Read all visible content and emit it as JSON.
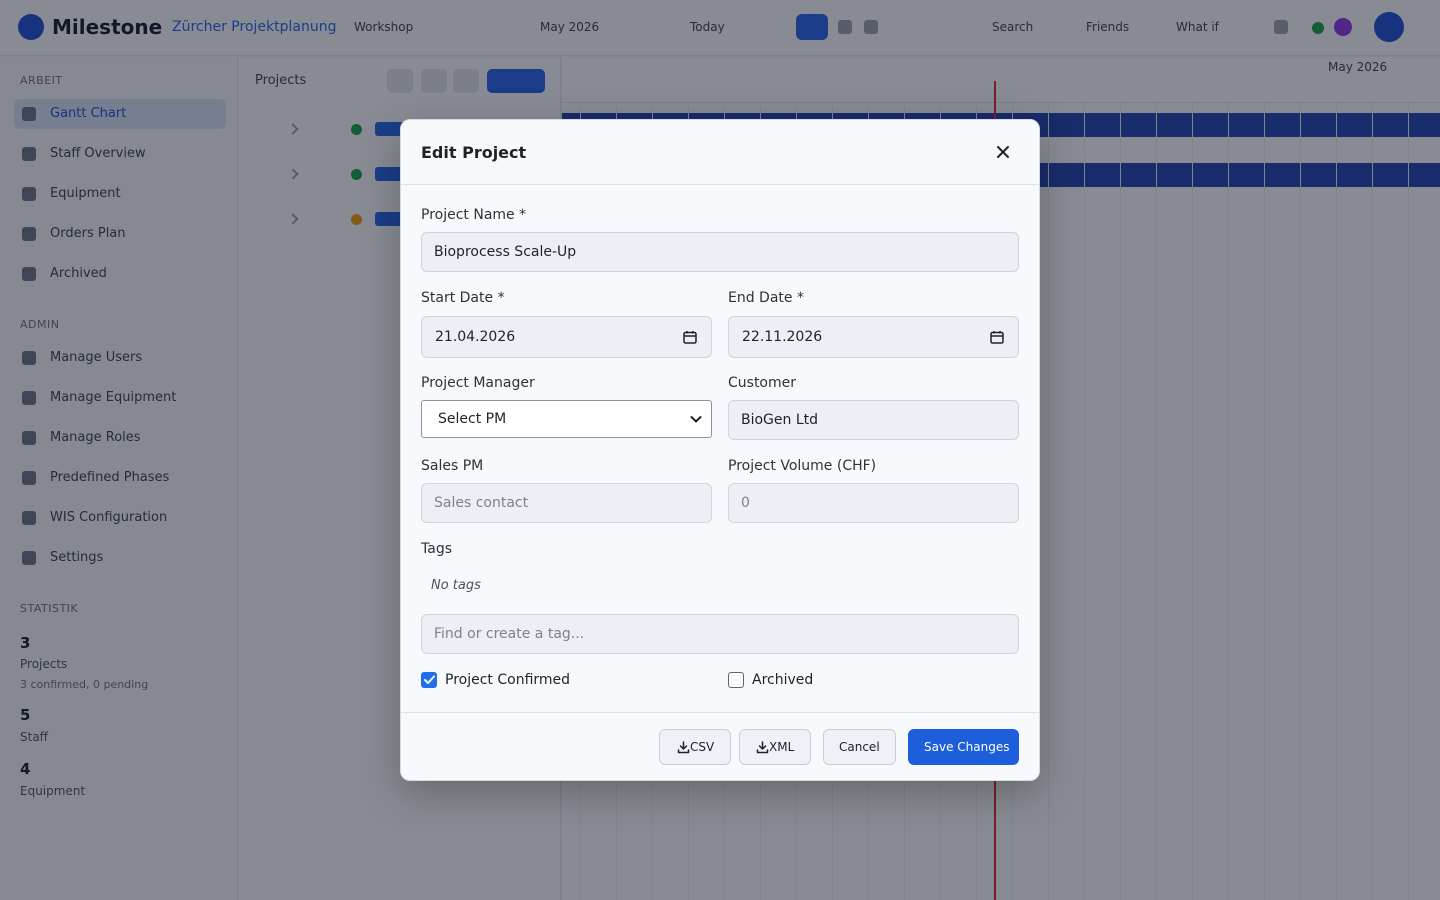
{
  "app": {
    "logo": "Milestone",
    "org": "Zürcher Projektplanung",
    "header_controls": [
      "Workshop",
      "May 2026",
      "Today",
      "Search",
      "Friends",
      "What if"
    ],
    "sidebar": {
      "sections": [
        "ARBEIT",
        "ADMIN",
        "STATISTIK"
      ],
      "items": [
        "Gantt Chart",
        "Staff Overview",
        "Equipment",
        "Orders Plan",
        "Archived",
        "Manage Users",
        "Manage Equipment",
        "Manage Roles",
        "Predefined Phases",
        "WIS Configuration",
        "Settings"
      ],
      "stats": [
        {
          "value": "3",
          "label": "Projects",
          "sub": "3 confirmed, 0 pending"
        },
        {
          "value": "5",
          "label": "Staff"
        },
        {
          "value": "4",
          "label": "Equipment"
        }
      ]
    },
    "projects_panel": {
      "title": "Projects"
    },
    "gantt": {
      "month": "May 2026"
    }
  },
  "modal": {
    "title": "Edit Project",
    "fields": {
      "project_name": {
        "label": "Project Name *",
        "value": "Bioprocess Scale-Up"
      },
      "start_date": {
        "label": "Start Date *",
        "value": "21.04.2026"
      },
      "end_date": {
        "label": "End Date *",
        "value": "22.11.2026"
      },
      "project_manager": {
        "label": "Project Manager",
        "selected": "Select PM"
      },
      "customer": {
        "label": "Customer",
        "value": "BioGen Ltd"
      },
      "sales_pm": {
        "label": "Sales PM",
        "placeholder": "Sales contact"
      },
      "project_volume": {
        "label": "Project Volume (CHF)",
        "placeholder": "0"
      },
      "tags": {
        "label": "Tags",
        "empty_text": "No tags",
        "placeholder": "Find or create a tag..."
      }
    },
    "checkboxes": {
      "confirmed": {
        "label": "Project Confirmed",
        "checked": true
      },
      "archived": {
        "label": "Archived",
        "checked": false
      }
    },
    "buttons": {
      "csv": "CSV",
      "xml": "XML",
      "cancel": "Cancel",
      "save": "Save Changes"
    }
  },
  "colors": {
    "primary": "#1d5fdb",
    "overlay": "rgba(17,24,39,0.5)",
    "gantt_bar": "#1e40af",
    "today_line": "#dc2626"
  },
  "icons": [
    "close-icon",
    "calendar-icon",
    "chevron-down-icon",
    "download-icon",
    "check-icon"
  ]
}
